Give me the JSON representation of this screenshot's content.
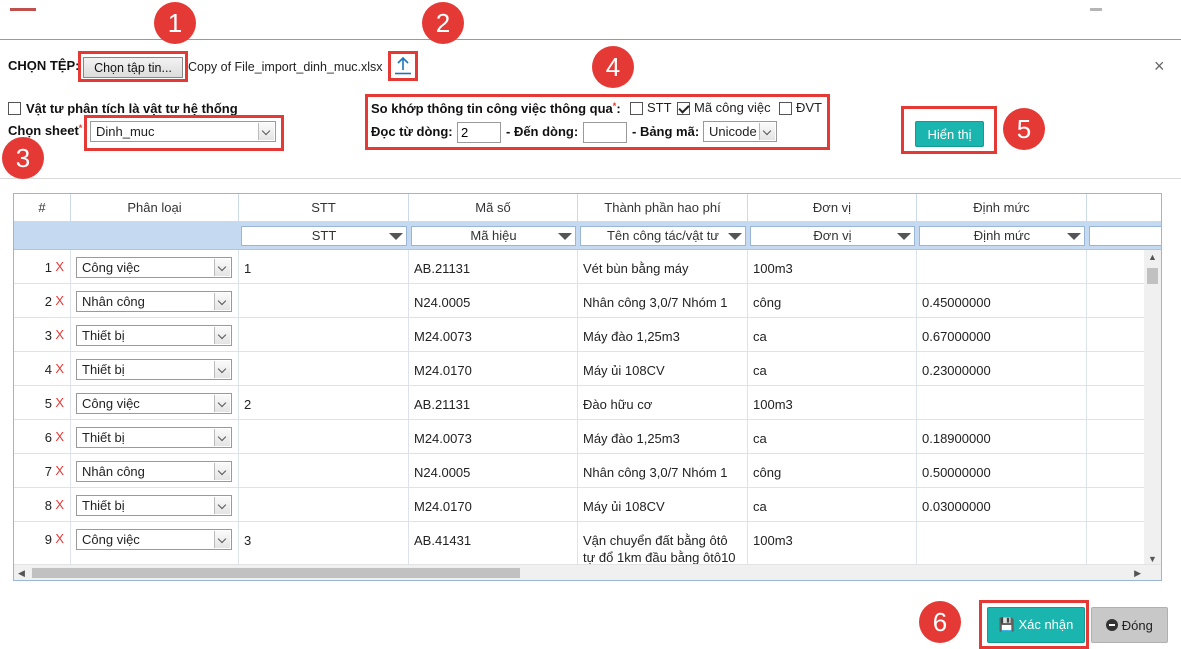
{
  "callouts": [
    "1",
    "2",
    "3",
    "4",
    "5",
    "6"
  ],
  "file": {
    "label": "CHỌN TỆP:",
    "choose_button": "Chọn tập tin...",
    "filename": "Copy of File_import_dinh_muc.xlsx",
    "upload_icon": "upload-arrow-icon",
    "close_icon": "close-icon"
  },
  "options": {
    "system_material_label": "Vật tư phân tích là vật tư hệ thống",
    "system_material_checked": false,
    "sheet_label": "Chọn sheet",
    "sheet_value": "Dinh_muc",
    "match_label": "So khớp thông tin công việc thông qua",
    "match_stt": "STT",
    "match_stt_checked": false,
    "match_code": "Mã công việc",
    "match_code_checked": true,
    "match_unit": "ĐVT",
    "match_unit_checked": false,
    "from_row_label": "Đọc từ dòng:",
    "from_row_value": "2",
    "to_row_label": "- Đến dòng:",
    "to_row_value": "",
    "encoding_label": "- Bảng mã:",
    "encoding_value": "Unicode",
    "show_button": "Hiển thị"
  },
  "grid": {
    "headers": [
      "#",
      "Phân loại",
      "STT",
      "Mã số",
      "Thành phần hao phí",
      "Đơn vị",
      "Định mức"
    ],
    "filters": [
      "STT",
      "Mã hiệu",
      "Tên công tác/vật tư",
      "Đơn vị",
      "Định mức"
    ],
    "rows": [
      {
        "num": "1",
        "type": "Công việc",
        "stt": "1",
        "code": "AB.21131",
        "name": "Vét bùn bằng máy",
        "name2": "",
        "unit": "100m3",
        "norm": ""
      },
      {
        "num": "2",
        "type": "Nhân công",
        "stt": "",
        "code": "N24.0005",
        "name": "Nhân công 3,0/7 Nhóm 1",
        "name2": "",
        "unit": "công",
        "norm": "0.45000000"
      },
      {
        "num": "3",
        "type": "Thiết bị",
        "stt": "",
        "code": "M24.0073",
        "name": "Máy đào 1,25m3",
        "name2": "",
        "unit": "ca",
        "norm": "0.67000000"
      },
      {
        "num": "4",
        "type": "Thiết bị",
        "stt": "",
        "code": "M24.0170",
        "name": "Máy ủi 108CV",
        "name2": "",
        "unit": "ca",
        "norm": "0.23000000"
      },
      {
        "num": "5",
        "type": "Công việc",
        "stt": "2",
        "code": "AB.21131",
        "name": "Đào hữu cơ",
        "name2": "",
        "unit": "100m3",
        "norm": ""
      },
      {
        "num": "6",
        "type": "Thiết bị",
        "stt": "",
        "code": "M24.0073",
        "name": "Máy đào 1,25m3",
        "name2": "",
        "unit": "ca",
        "norm": "0.18900000"
      },
      {
        "num": "7",
        "type": "Nhân công",
        "stt": "",
        "code": "N24.0005",
        "name": "Nhân công 3,0/7 Nhóm 1",
        "name2": "",
        "unit": "công",
        "norm": "0.50000000"
      },
      {
        "num": "8",
        "type": "Thiết bị",
        "stt": "",
        "code": "M24.0170",
        "name": "Máy ủi 108CV",
        "name2": "",
        "unit": "ca",
        "norm": "0.03000000"
      },
      {
        "num": "9",
        "type": "Công việc",
        "stt": "3",
        "code": "AB.41431",
        "name": "Vận chuyển đất bằng ôtô",
        "name2": "tự đổ 1km đầu bằng ôtô10",
        "unit": "100m3",
        "norm": ""
      }
    ],
    "delete_mark": "X"
  },
  "footer": {
    "confirm_button": "Xác nhận",
    "confirm_icon": "save-icon",
    "close_button": "Đóng",
    "close_icon": "minus-circle-icon"
  },
  "colors": {
    "callout": "#e53935",
    "teal": "#19b5ae",
    "filter_row": "#c5d9f1"
  }
}
